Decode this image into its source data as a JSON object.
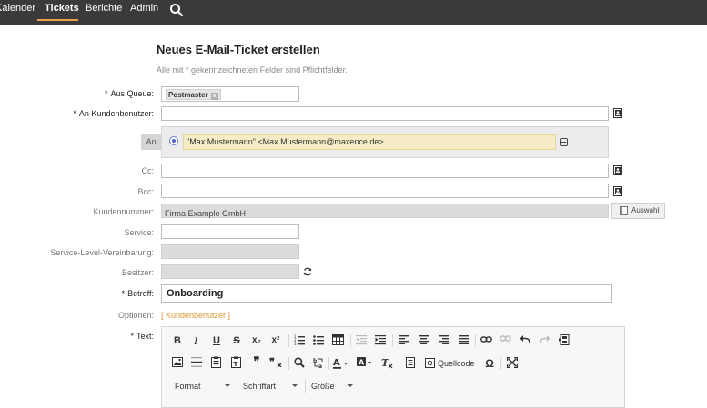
{
  "nav": {
    "items": [
      {
        "label": "Kalender",
        "active": false
      },
      {
        "label": "Tickets",
        "active": true
      },
      {
        "label": "Berichte",
        "active": false
      },
      {
        "label": "Admin",
        "active": false
      }
    ],
    "search_icon": "search-icon",
    "accent_color": "#e8a24a"
  },
  "form": {
    "title": "Neues E-Mail-Ticket erstellen",
    "subtitle": "Alle mit * gekennzeichneten Felder sind Pflichtfelder.",
    "required_marker": "*",
    "fields": {
      "queue": {
        "label": "Aus Queue:",
        "chip": "Postmaster",
        "chip_remove": "x"
      },
      "customer_user": {
        "label": "An Kundenbenutzer:",
        "value": ""
      },
      "to": {
        "button": "An",
        "recipient": "\"Max Mustermann\" <Max.Mustermann@maxence.de>"
      },
      "cc": {
        "label": "Cc:",
        "value": ""
      },
      "bcc": {
        "label": "Bcc:",
        "value": ""
      },
      "customer_id": {
        "label": "Kundennummer:",
        "value": "Firma Example GmbH",
        "button": "Auswahl"
      },
      "service": {
        "label": "Service:",
        "value": ""
      },
      "sla": {
        "label": "Service-Level-Vereinbarung:",
        "value": ""
      },
      "owner": {
        "label": "Besitzer:",
        "value": ""
      },
      "subject": {
        "label": "Betreff:",
        "value": "Onboarding"
      },
      "options": {
        "label": "Optionen:",
        "link": "[ Kundenbenutzer ]"
      },
      "text": {
        "label": "Text:"
      }
    }
  },
  "editor": {
    "row1": {
      "bold": "B",
      "italic": "I",
      "underline": "U",
      "strike": "S",
      "subscript": "x₂",
      "superscript": "x²"
    },
    "row2": {
      "source": "Quellcode",
      "omega": "Ω"
    },
    "row3": {
      "format": "Format",
      "font": "Schriftart",
      "size": "Größe"
    }
  }
}
